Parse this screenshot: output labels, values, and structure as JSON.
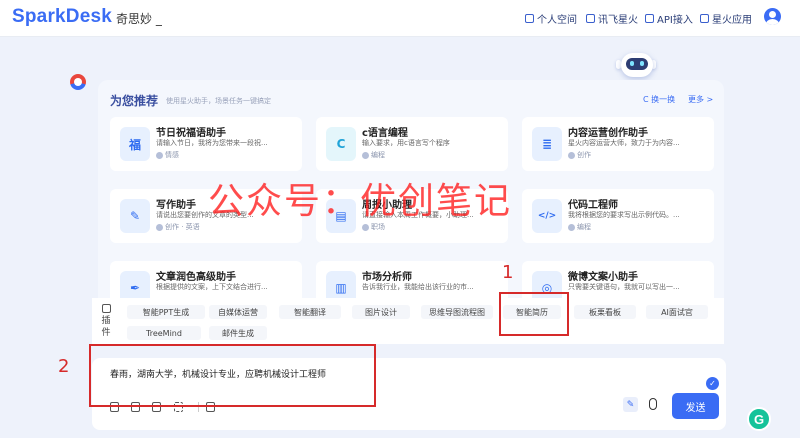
{
  "header": {
    "logo": "SparkDesk",
    "subtitle": "奇思妙 _",
    "nav": [
      {
        "label": "个人空间",
        "icon": "personal-space-icon"
      },
      {
        "label": "讯飞星火",
        "icon": "spark-icon"
      },
      {
        "label": "API接入",
        "icon": "api-icon"
      },
      {
        "label": "星火应用",
        "icon": "apps-icon"
      }
    ],
    "avatar_icon": "user-avatar-icon"
  },
  "recommend": {
    "title": "为您推荐",
    "subtitle": "使用星火助手，场景任务一键搞定",
    "refresh": "C 换一换",
    "more": "更多 >"
  },
  "cards": [
    {
      "title": "节日祝福语助手",
      "desc": "请输入节日，我将为您带来一段祝...",
      "tag": "情感",
      "glyph": "福"
    },
    {
      "title": "c语言编程",
      "desc": "输入要求，用c语言写个程序",
      "tag": "编程",
      "glyph": "C"
    },
    {
      "title": "内容运营创作助手",
      "desc": "星火内容运营大师，致力于为内容...",
      "tag": "创作",
      "glyph": "≣"
    },
    {
      "title": "写作助手",
      "desc": "请说出您要创作的文章的类型...",
      "tag": "创作 · 英语",
      "glyph": "✎"
    },
    {
      "title": "周报小助理",
      "desc": "请直接输入本周工作概要，小助理...",
      "tag": "职场",
      "glyph": "▤"
    },
    {
      "title": "代码工程师",
      "desc": "我将根据您的要求写出示例代码。...",
      "tag": "编程",
      "glyph": "</>"
    },
    {
      "title": "文章润色高级助手",
      "desc": "根据提供的文案，上下文结合进行...",
      "tag": "",
      "glyph": "✒"
    },
    {
      "title": "市场分析师",
      "desc": "告诉我行业，我能给出该行业的市...",
      "tag": "",
      "glyph": "▥"
    },
    {
      "title": "微博文案小助手",
      "desc": "只需要关键语句，我就可以写出一...",
      "tag": "",
      "glyph": "◎"
    }
  ],
  "plugins": {
    "label": "插件",
    "items": [
      "智能PPT生成",
      "自媒体运营",
      "智能翻译",
      "图片设计",
      "思维导图流程图",
      "智能简历",
      "板栗看板",
      "AI面试官",
      "TreeMind",
      "邮件生成"
    ]
  },
  "input": {
    "text": "春雨，湖南大学，机械设计专业，应聘机械设计工程师",
    "send": "发送"
  },
  "annotations": {
    "watermark": "公众号：优创笔记",
    "label1": "1",
    "label2": "2"
  },
  "colors": {
    "accent": "#3a6cf4",
    "annotation": "#d62a2a",
    "grammarly": "#15c39a"
  }
}
